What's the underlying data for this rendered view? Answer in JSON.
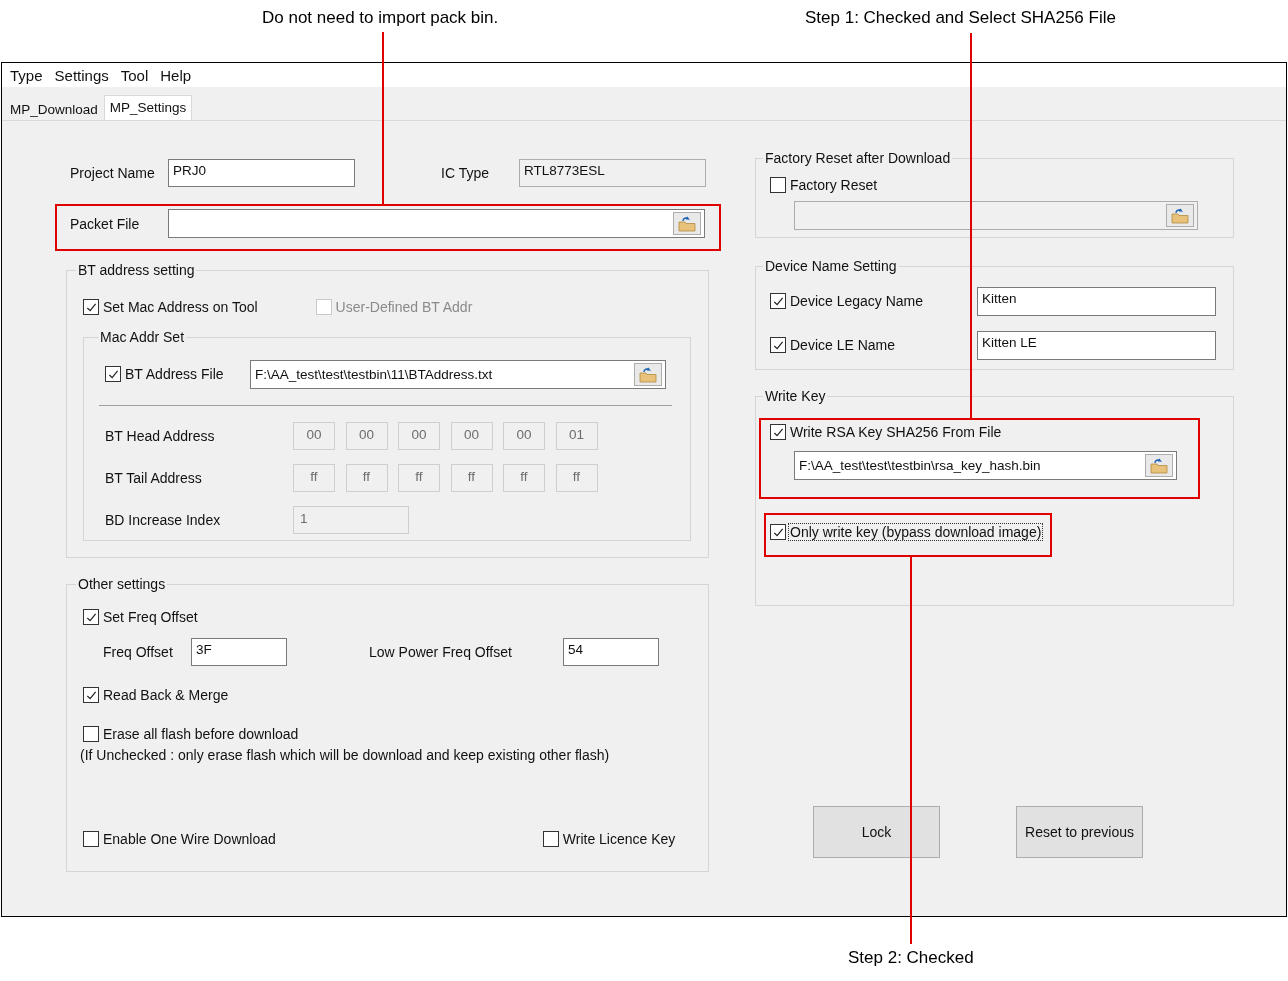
{
  "annotations": [
    {
      "text": "Do not need to import pack bin."
    },
    {
      "text": "Step 1: Checked and Select SHA256 File"
    },
    {
      "text": "Step 2: Checked"
    }
  ],
  "menu": [
    "Type",
    "Settings",
    "Tool",
    "Help"
  ],
  "tabs": [
    {
      "label": "MP_Download",
      "selected": false
    },
    {
      "label": "MP_Settings",
      "selected": true
    }
  ],
  "project": {
    "project_name_label": "Project Name",
    "project_name": "PRJ0",
    "ic_type_label": "IC Type",
    "ic_type": "RTL8773ESL",
    "packet_file_label": "Packet File"
  },
  "bt_address": {
    "title": "BT address setting",
    "set_mac": {
      "label": "Set Mac Address on Tool",
      "checked": true,
      "disabled": false
    },
    "user_defined": {
      "label": "User-Defined BT Addr",
      "checked": false,
      "disabled": true
    },
    "mac_addr_set": {
      "title": "Mac Addr Set",
      "bt_address_file": {
        "label": "BT Address File",
        "checked": true,
        "disabled": false,
        "value": "F:\\AA_test\\test\\testbin\\11\\BTAddress.txt"
      },
      "head": {
        "label": "BT Head Address",
        "bytes": [
          "00",
          "00",
          "00",
          "00",
          "00",
          "01"
        ]
      },
      "tail": {
        "label": "BT Tail Address",
        "bytes": [
          "ff",
          "ff",
          "ff",
          "ff",
          "ff",
          "ff"
        ]
      },
      "increase": {
        "label": "BD Increase Index",
        "value": "1"
      }
    }
  },
  "other": {
    "title": "Other settings",
    "set_freq": {
      "label": "Set Freq Offset",
      "checked": true,
      "disabled": false
    },
    "freq_offset_label": "Freq Offset",
    "freq_offset": "3F",
    "low_power_label": "Low Power Freq Offset",
    "low_power": "54",
    "read_back": {
      "label": "Read Back & Merge",
      "checked": true,
      "disabled": false
    },
    "erase_all": {
      "label": "Erase all flash before download",
      "checked": false,
      "disabled": false
    },
    "erase_note": "(If Unchecked : only erase flash which will be download and keep existing other flash)",
    "one_wire": {
      "label": "Enable One Wire Download",
      "checked": false,
      "disabled": false
    },
    "licence": {
      "label": "Write Licence Key",
      "checked": false,
      "disabled": false
    }
  },
  "factory": {
    "title": "Factory Reset after Download",
    "factory_reset": {
      "label": "Factory Reset",
      "checked": false,
      "disabled": false
    }
  },
  "device_name": {
    "title": "Device Name Setting",
    "items": [
      {
        "label": "Device Legacy Name",
        "checked": true,
        "disabled": false,
        "value": "Kitten"
      },
      {
        "label": "Device LE Name",
        "checked": true,
        "disabled": false,
        "value": "Kitten LE"
      }
    ]
  },
  "write_key": {
    "title": "Write Key",
    "rsa": {
      "label": "Write RSA Key SHA256 From File",
      "checked": true,
      "disabled": false,
      "value": "F:\\AA_test\\test\\testbin\\rsa_key_hash.bin"
    },
    "only_write": {
      "label": "Only write key (bypass download image)",
      "checked": true,
      "disabled": false,
      "focused": true
    }
  },
  "buttons": [
    "Lock",
    "Reset to previous"
  ]
}
